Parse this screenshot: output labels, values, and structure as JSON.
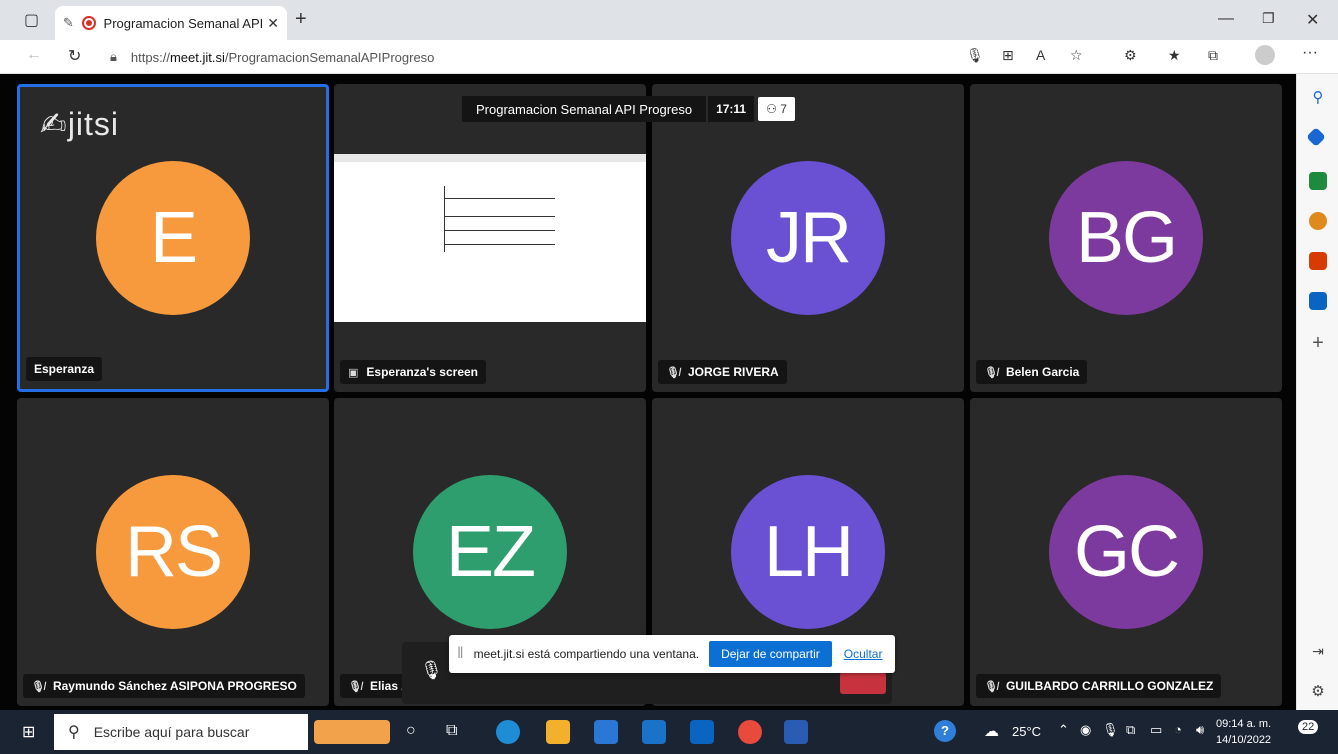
{
  "browser": {
    "tab_title": "Programacion Semanal API",
    "url_prefix": "https://",
    "url_domain": "meet.jit.si",
    "url_path": "/ProgramacionSemanalAPIProgreso"
  },
  "meeting": {
    "logo_text": "jitsi",
    "title": "Programacion Semanal API Progreso",
    "time": "17:11",
    "participant_count": "7"
  },
  "tiles": [
    {
      "initials": "E",
      "name": "Esperanza",
      "color": "#f79a3e",
      "muted": false
    },
    {
      "initials": "",
      "name": "Esperanza's screen",
      "color": "",
      "muted": false
    },
    {
      "initials": "JR",
      "name": "JORGE RIVERA",
      "color": "#6a50d3",
      "muted": true
    },
    {
      "initials": "BG",
      "name": "Belen Garcia",
      "color": "#7d3a9e",
      "muted": true
    },
    {
      "initials": "RS",
      "name": "Raymundo Sánchez ASIPONA PROGRESO",
      "color": "#f79a3e",
      "muted": true
    },
    {
      "initials": "EZ",
      "name": "Elias Z",
      "color": "#2e9e6f",
      "muted": true
    },
    {
      "initials": "LH",
      "name": "",
      "color": "#6a50d3",
      "muted": false
    },
    {
      "initials": "GC",
      "name": "GUILBARDO CARRILLO GONZALEZ",
      "color": "#7d3a9e",
      "muted": true
    }
  ],
  "sharing_bar": {
    "message": "meet.jit.si está compartiendo una ventana.",
    "stop_label": "Dejar de compartir",
    "hide_label": "Ocultar"
  },
  "taskbar": {
    "search_placeholder": "Escribe aquí para buscar",
    "temperature": "25°C",
    "time": "09:14 a. m.",
    "date": "14/10/2022",
    "notifications": "22"
  }
}
